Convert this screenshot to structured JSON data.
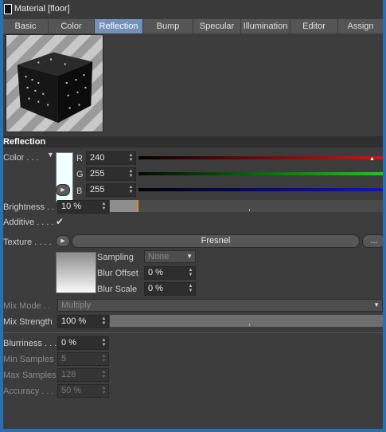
{
  "window": {
    "title": "Material [floor]"
  },
  "tabs": [
    {
      "label": "Basic"
    },
    {
      "label": "Color"
    },
    {
      "label": "Reflection"
    },
    {
      "label": "Bump"
    },
    {
      "label": "Specular"
    },
    {
      "label": "Illumination"
    },
    {
      "label": "Editor"
    },
    {
      "label": "Assign"
    }
  ],
  "active_tab": "Reflection",
  "section": {
    "title": "Reflection"
  },
  "color": {
    "label": "Color . . .",
    "r_label": "R",
    "r_value": "240",
    "g_label": "G",
    "g_value": "255",
    "b_label": "B",
    "b_value": "255",
    "swatch_color": "#f0ffff"
  },
  "brightness": {
    "label": "Brightness . .",
    "value": "10 %",
    "level": 0.1
  },
  "additive": {
    "label": "Additive . . . .",
    "checked": true
  },
  "texture": {
    "label": "Texture . . . .",
    "shader_name": "Fresnel",
    "more_label": "...",
    "sampling_label": "Sampling",
    "sampling_value": "None",
    "blur_offset_label": "Blur Offset",
    "blur_offset_value": "0 %",
    "blur_scale_label": "Blur Scale",
    "blur_scale_value": "0 %"
  },
  "mix_mode": {
    "label": "Mix Mode . .",
    "value": "Multiply"
  },
  "mix_strength": {
    "label": "Mix Strength",
    "value": "100 %",
    "level": 1.0
  },
  "blurriness": {
    "label": "Blurriness . . .",
    "value": "0 %"
  },
  "min_samples": {
    "label": "Min Samples",
    "value": "5"
  },
  "max_samples": {
    "label": "Max Samples",
    "value": "128"
  },
  "accuracy": {
    "label": "Accuracy . . .",
    "value": "50 %"
  },
  "colors": {
    "accent": "#7391b8",
    "background": "#3c3c3c",
    "frame": "#2a6fb0"
  }
}
